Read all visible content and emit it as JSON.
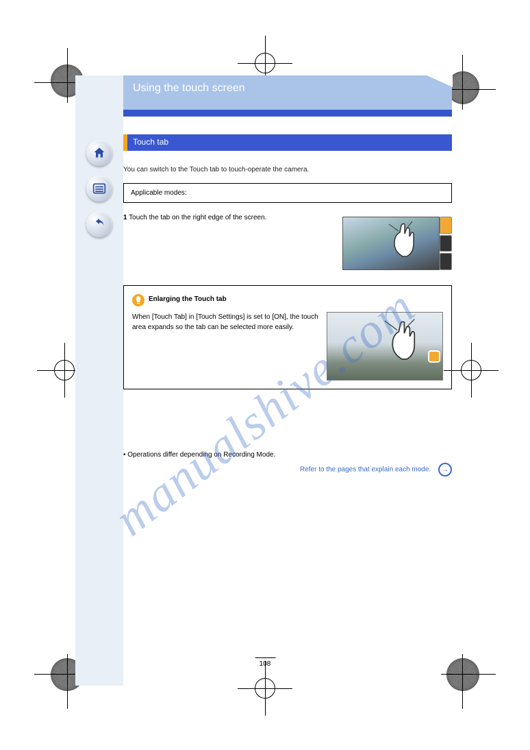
{
  "page_number": "108",
  "watermark": "manualshive.com",
  "title_banner": "Using the touch screen",
  "section_heading": "Touch tab",
  "intro_text": "You can switch to the Touch tab to touch-operate the camera.",
  "mode_box": "Applicable modes:",
  "step1_num": "1",
  "step1_text": "Touch the tab on the right edge of the screen.",
  "tip_heading": "Enlarging the Touch tab",
  "tip_body": "When [Touch Tab] in [Touch Settings] is set to [ON], the touch area expands so the tab can be selected more easily.",
  "footer_line": "• Operations differ depending on Recording Mode.",
  "footer_link_text": "Refer to the pages that explain each mode.",
  "nav": {
    "home": "Home",
    "menu": "Menu",
    "back": "Back"
  }
}
